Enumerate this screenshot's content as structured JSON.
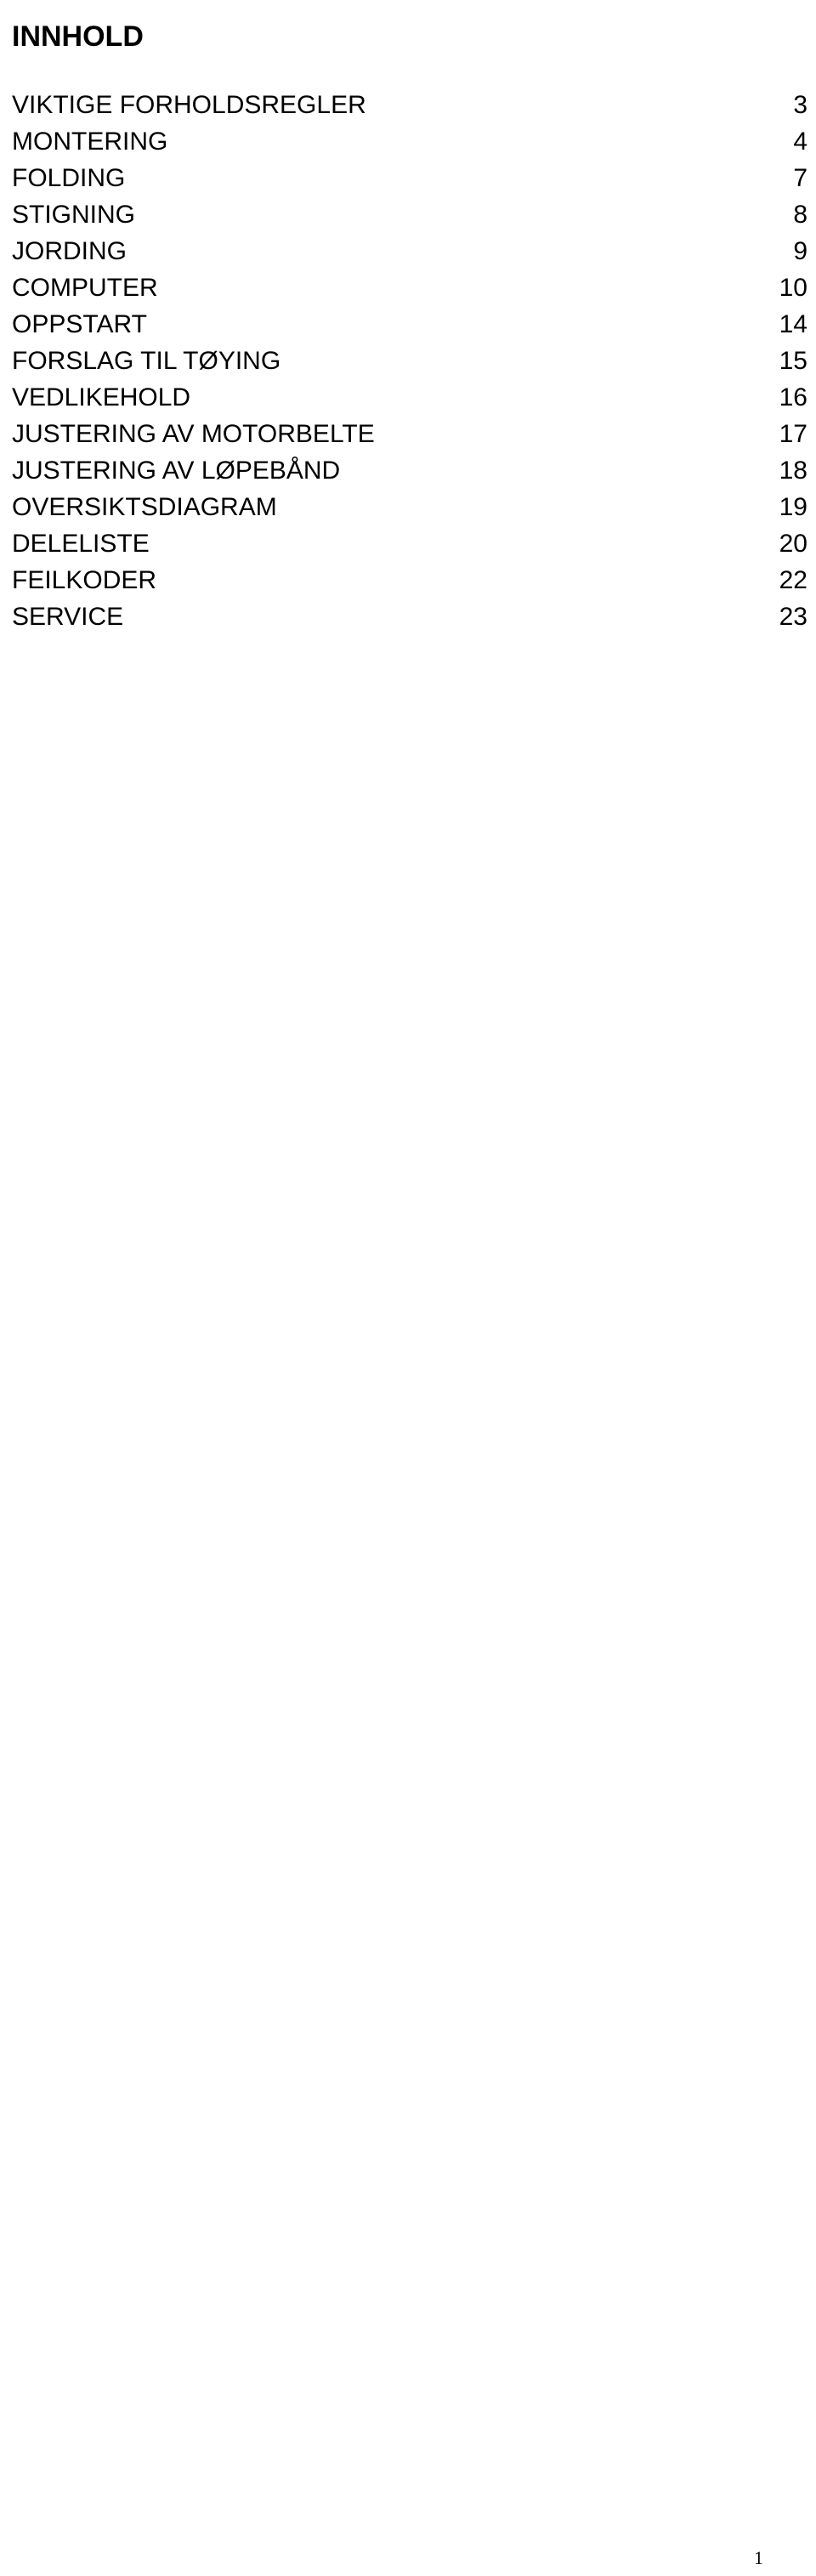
{
  "document": {
    "title": "INNHOLD",
    "language": "Norwegian"
  },
  "toc": {
    "entries": [
      {
        "label": "VIKTIGE FORHOLDSREGLER",
        "page": "3"
      },
      {
        "label": "MONTERING",
        "page": "4"
      },
      {
        "label": "FOLDING",
        "page": "7"
      },
      {
        "label": "STIGNING",
        "page": "8"
      },
      {
        "label": "JORDING",
        "page": "9"
      },
      {
        "label": "COMPUTER",
        "page": "10"
      },
      {
        "label": "OPPSTART",
        "page": "14"
      },
      {
        "label": "FORSLAG TIL TØYING",
        "page": "15"
      },
      {
        "label": "VEDLIKEHOLD",
        "page": "16"
      },
      {
        "label": "JUSTERING AV MOTORBELTE",
        "page": "17"
      },
      {
        "label": "JUSTERING AV LØPEBÅND",
        "page": "18"
      },
      {
        "label": "OVERSIKTSDIAGRAM",
        "page": "19"
      },
      {
        "label": "DELELISTE",
        "page": "20"
      },
      {
        "label": "FEILKODER",
        "page": "22"
      },
      {
        "label": "SERVICE",
        "page": "23"
      }
    ]
  },
  "footer": {
    "page_number": "1"
  }
}
